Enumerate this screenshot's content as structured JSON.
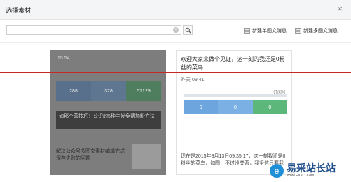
{
  "dialog": {
    "title": "选择素材",
    "close_glyph": "×"
  },
  "toolbar": {
    "search_placeholder": "",
    "clear_glyph": "×",
    "new_single_label": "新建单图文消息",
    "new_multi_label": "新建多图文消息"
  },
  "left_card": {
    "time": "15:54",
    "stats": [
      "288",
      "328",
      "57129"
    ],
    "caption": "如那个营技巧：公识的5种主发免费加粉方法",
    "subtitle": "解决公众号多图文素材编辑完成保存失败的问题"
  },
  "right_card": {
    "headline": "欢迎大家来做个见证，这一刻的我还是0粉丝的菜鸟……",
    "time": "昨天  09:41",
    "stats": [
      "0",
      "0",
      "0"
    ],
    "tag": "订阅号",
    "description": "现在是2015年3月13日09:35:17，这一刻我还是0粉丝的菜鸟，如图：不过没关系，我坚信只要我"
  },
  "watermark": {
    "logo_glyph": "e",
    "main": "易采站长站",
    "sub": "Www.EaXCl.Com"
  },
  "colors": {
    "stat_blue": "#6da6df",
    "stat_green": "#5cb77a",
    "overlay": "#7d7d7d",
    "red_line": "#c62828"
  }
}
